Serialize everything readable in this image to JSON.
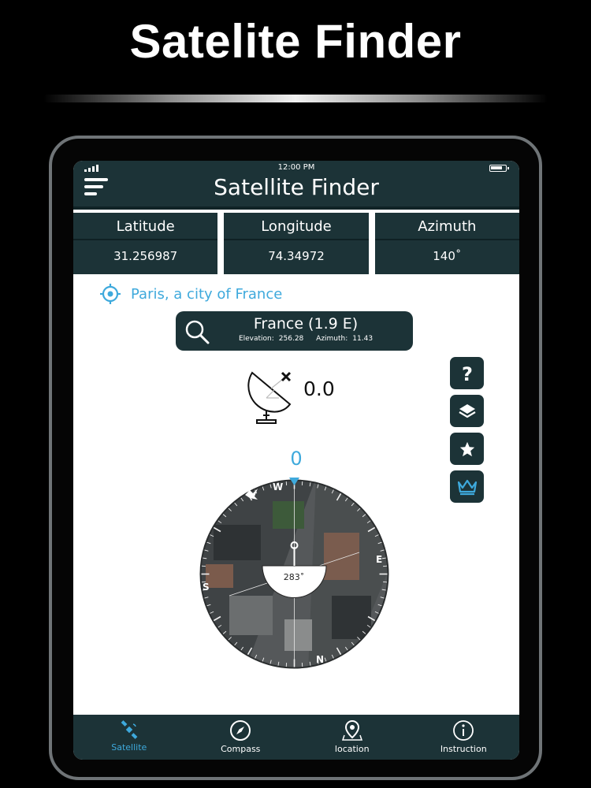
{
  "promo": {
    "headline": "Satelite Finder"
  },
  "status_bar": {
    "time": "12:00 PM"
  },
  "header": {
    "title": "Satellite Finder"
  },
  "stats": [
    {
      "label": "Latitude",
      "value": "31.256987"
    },
    {
      "label": "Longitude",
      "value": "74.34972"
    },
    {
      "label": "Azimuth",
      "value": "140˚"
    }
  ],
  "location": {
    "text": "Paris, a city of France"
  },
  "search": {
    "country": "France (1.9 E)",
    "elevation_label": "Elevation:",
    "elevation_value": "256.28",
    "azimuth_label": "Azimuth:",
    "azimuth_value": "11.43"
  },
  "dish": {
    "value": "0.0"
  },
  "compass": {
    "heading_value": "0",
    "dial_reading": "283˚",
    "letters": {
      "north": "N",
      "west": "W",
      "south": "S",
      "east": "E"
    }
  },
  "side_buttons": [
    {
      "name": "help-button",
      "icon": "question-icon"
    },
    {
      "name": "layers-button",
      "icon": "layers-icon"
    },
    {
      "name": "favorites-button",
      "icon": "star-icon"
    },
    {
      "name": "premium-button",
      "icon": "crown-icon"
    }
  ],
  "bottom_nav": [
    {
      "label": "Satellite",
      "icon": "satellite-icon",
      "active": true
    },
    {
      "label": "Compass",
      "icon": "compass-icon",
      "active": false
    },
    {
      "label": "location",
      "icon": "map-pin-icon",
      "active": false
    },
    {
      "label": "Instruction",
      "icon": "info-icon",
      "active": false
    }
  ],
  "colors": {
    "panel": "#1c3337",
    "accent": "#3ea9dc",
    "background": "#000000",
    "screen": "#ffffff"
  }
}
